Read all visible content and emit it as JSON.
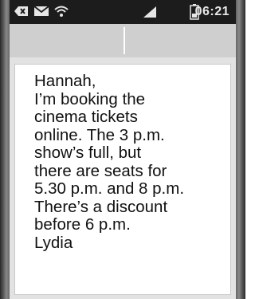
{
  "status_bar": {
    "time": "06:21",
    "icons": [
      "close-notification-icon",
      "mail-icon",
      "wifi-icon",
      "signal-icon",
      "battery-icon"
    ]
  },
  "message": {
    "lines": [
      "Hannah,",
      "I’m booking the",
      "cinema tickets",
      "online. The 3 p.m.",
      "show’s full, but",
      "there are seats for",
      "5.30 p.m. and 8 p.m.",
      "There’s a discount",
      "before 6 p.m.",
      "Lydia"
    ]
  }
}
